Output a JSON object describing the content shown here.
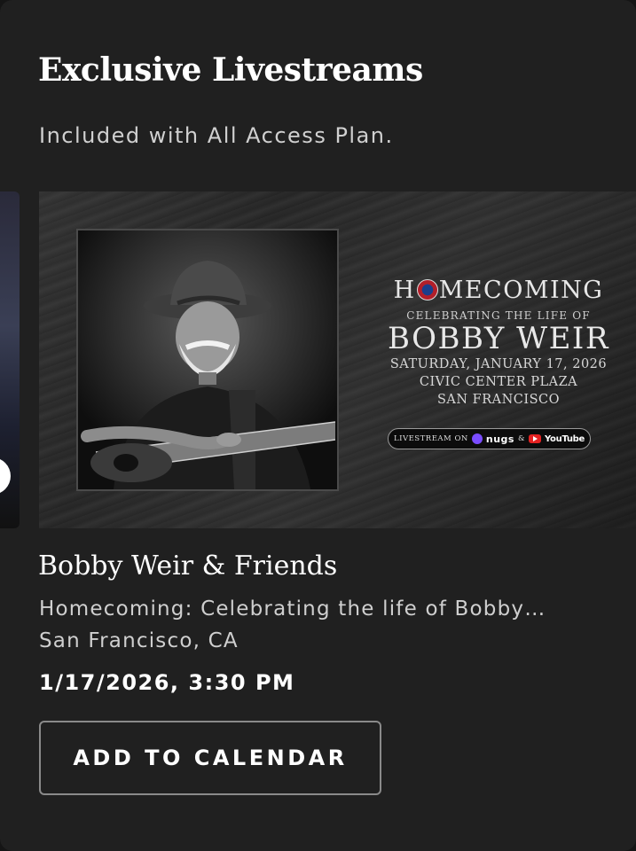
{
  "section": {
    "title": "Exclusive Livestreams",
    "subtitle": "Included with All Access Plan."
  },
  "poster": {
    "headline_pre": "H",
    "headline_post": "MECOMING",
    "kicker": "CELEBRATING THE LIFE OF",
    "name": "BOBBY WEIR",
    "date_line": "SATURDAY, JANUARY 17, 2026",
    "venue_line": "CIVIC CENTER PLAZA",
    "city_line": "SAN FRANCISCO",
    "stream_prefix": "LIVESTREAM ON",
    "stream_nugs": "nugs",
    "stream_amp": "&",
    "stream_youtube": "YouTube",
    "icons": [
      "steal-your-face-logo-icon",
      "nugs-icon",
      "youtube-icon"
    ]
  },
  "event": {
    "title": "Bobby Weir & Friends",
    "description": "Homecoming: Celebrating the life of Bobby…",
    "location": "San Francisco, CA",
    "datetime": "1/17/2026, 3:30 PM"
  },
  "actions": {
    "calendar_label": "ADD TO CALENDAR"
  },
  "colors": {
    "background": "#202020",
    "text_primary": "#ffffff",
    "text_secondary": "#cfcfcf",
    "button_border": "#8a8a8a",
    "youtube_red": "#e52222",
    "nugs_purple": "#7a4cff"
  }
}
